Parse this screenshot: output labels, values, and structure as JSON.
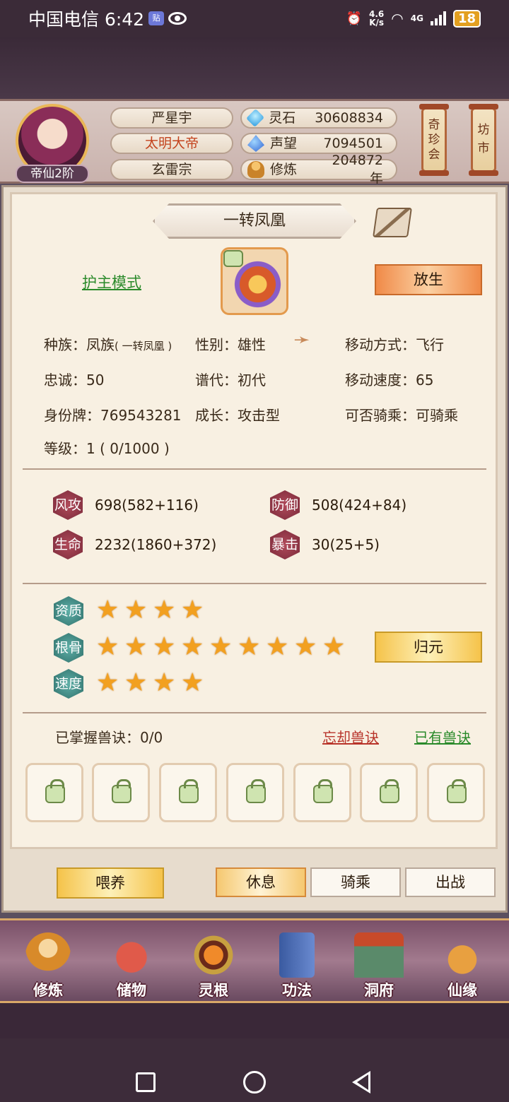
{
  "status_bar": {
    "carrier_time": "中国电信 6:42",
    "badge": "贴",
    "speed_value": "4.6",
    "speed_unit": "K/s",
    "network": "4G",
    "battery": "18"
  },
  "header": {
    "avatar_rank": "帝仙2阶",
    "player_name": "严星宇",
    "player_title": "太明大帝",
    "sect": "玄雷宗",
    "spirit_stone_label": "灵石",
    "spirit_stone_value": "30608834",
    "prestige_label": "声望",
    "prestige_value": "7094501",
    "cultivation_label": "修炼",
    "cultivation_value": "204872年",
    "lantern_treasure": "奇珍会",
    "lantern_market": "坊市"
  },
  "pet": {
    "name": "一转凤凰",
    "guard_mode": "护主模式",
    "release": "放生",
    "race_label": "种族：",
    "race_value": "凤族",
    "race_sub": "( 一转凤凰 )",
    "gender_label": "性别：",
    "gender_value": "雄性",
    "move_label": "移动方式：",
    "move_value": "飞行",
    "loyalty_label": "忠诚：",
    "loyalty_value": "50",
    "generation_label": "谱代：",
    "generation_value": "初代",
    "speed_label": "移动速度：",
    "speed_value": "65",
    "id_label": "身份牌：",
    "id_value": "769543281",
    "growth_label": "成长：",
    "growth_value": "攻击型",
    "rideable_label": "可否骑乘：",
    "rideable_value": "可骑乘",
    "level_label": "等级：",
    "level_value": "1 ( 0/1000 )"
  },
  "stats": {
    "attack_label": "风攻",
    "attack_value": "698(582+116)",
    "defense_label": "防御",
    "defense_value": "508(424+84)",
    "hp_label": "生命",
    "hp_value": "2232(1860+372)",
    "crit_label": "暴击",
    "crit_value": "30(25+5)"
  },
  "aptitude": {
    "quality_label": "资质",
    "quality_stars": 4,
    "bone_label": "根骨",
    "bone_stars": 9,
    "speed_label": "速度",
    "speed_stars": 4,
    "reset_button": "归元"
  },
  "skills": {
    "mastered_label": "已掌握兽诀：",
    "mastered_value": "0/0",
    "forget": "忘却兽诀",
    "owned": "已有兽诀",
    "slots": 7
  },
  "actions": {
    "feed": "喂养",
    "rest": "休息",
    "ride": "骑乘",
    "battle": "出战"
  },
  "bottom_nav": [
    {
      "label": "修炼",
      "icon": "monk-icon"
    },
    {
      "label": "储物",
      "icon": "bag-icon"
    },
    {
      "label": "灵根",
      "icon": "spirit-root-icon"
    },
    {
      "label": "功法",
      "icon": "scroll-book-icon"
    },
    {
      "label": "洞府",
      "icon": "cave-house-icon"
    },
    {
      "label": "仙缘",
      "icon": "gourd-icon"
    }
  ],
  "colors": {
    "title_red": "#c3431d",
    "link_green": "#2a8a2a",
    "link_red": "#b8342a",
    "star": "#f2a020"
  }
}
